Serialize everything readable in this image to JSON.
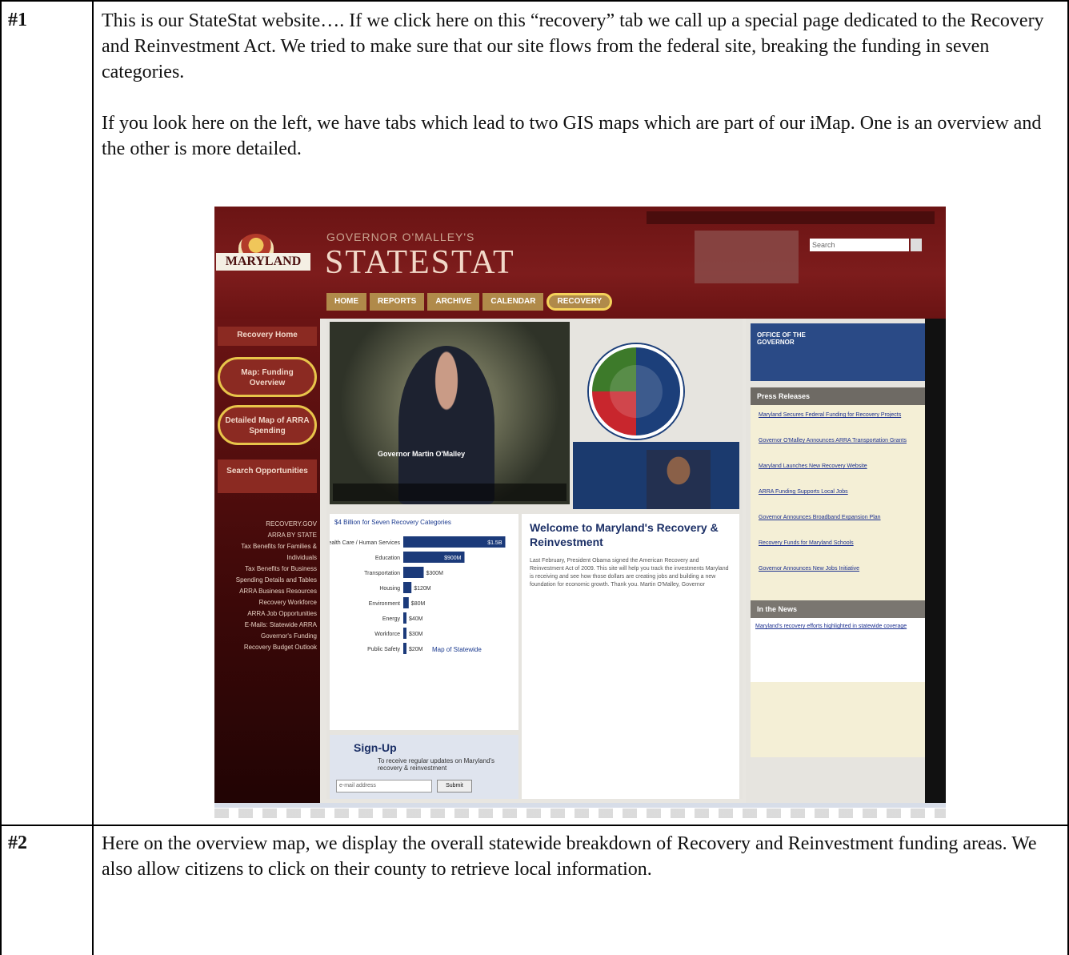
{
  "rows": [
    {
      "number": "#1",
      "paragraphs": [
        "This is our StateStat website…. If we click here on this “recovery” tab we call up a special page dedicated to the Recovery and Reinvestment Act.  We tried to make sure that our site flows from the federal site, breaking the funding in seven categories.",
        "If you look here on the left, we have tabs which lead to two GIS maps which are part of our iMap.  One is an overview and the other is more detailed."
      ]
    },
    {
      "number": "#2",
      "paragraphs": [
        "Here on the overview map, we display the overall statewide breakdown of Recovery and Reinvestment funding areas.  We also allow citizens to click on their county to retrieve local information."
      ]
    }
  ],
  "screenshot": {
    "logo_text": "MARYLAND",
    "governor_line": "GOVERNOR O'MALLEY'S",
    "site_title": "STATESTAT",
    "search_placeholder": "Search",
    "tabs": [
      "HOME",
      "REPORTS",
      "ARCHIVE",
      "CALENDAR",
      "RECOVERY"
    ],
    "left_nav": {
      "recovery_home": "Recovery Home",
      "funding_overview": "Map: Funding Overview",
      "detailed_map": "Detailed Map of ARRA Spending",
      "search_opportunities": "Search Opportunities",
      "links": [
        "RECOVERY.GOV",
        "ARRA BY STATE",
        "Tax Benefits for Families & Individuals",
        "Tax Benefits for Business",
        "Spending Details and Tables",
        "ARRA Business Resources",
        "Recovery Workforce",
        "ARRA Job Opportunities",
        "E-Mails: Statewide ARRA",
        "Governor's Funding",
        "Recovery Budget Outlook"
      ]
    },
    "video_caption": "Governor Martin O'Malley",
    "chart": {
      "title": "$4 Billion for Seven Recovery Categories",
      "link": "Map of Statewide"
    },
    "signup": {
      "title": "Sign-Up",
      "text": "To receive regular updates on Maryland's recovery & reinvestment",
      "input_placeholder": "e-mail address",
      "button": "Submit"
    },
    "welcome": {
      "title": "Welcome to Maryland's Recovery & Reinvestment",
      "body": "Last February, President Obama signed the American Recovery and Reinvestment Act of 2009. This site will help you track the investments Maryland is receiving and see how those dollars are creating jobs and building a new foundation for economic growth. Thank you. Martin O'Malley, Governor"
    },
    "right": {
      "banner": "OFFICE OF THE GOVERNOR",
      "press_head": "Press Releases",
      "press_items": [
        "Maryland Secures Federal Funding for Recovery Projects",
        "Governor O'Malley Announces ARRA Transportation Grants",
        "Maryland Launches New Recovery Website",
        "ARRA Funding Supports Local Jobs",
        "Governor Announces Broadband Expansion Plan",
        "Recovery Funds for Maryland Schools",
        "Governor Announces New Jobs Initiative"
      ],
      "news_head": "In the News",
      "news_body": "Maryland's recovery efforts highlighted in statewide coverage"
    },
    "chart_data": {
      "type": "bar",
      "title": "$4 Billion for Seven Recovery Categories",
      "categories": [
        "Health Care / Human Services",
        "Education",
        "Transportation",
        "Housing",
        "Environment",
        "Energy",
        "Workforce",
        "Public Safety"
      ],
      "values": [
        1500,
        900,
        300,
        120,
        80,
        40,
        30,
        20
      ],
      "value_labels": [
        "$1.5B",
        "$900M",
        "$300M",
        "$120M",
        "$80M",
        "$40M",
        "$30M",
        "$20M"
      ],
      "xlim": [
        0,
        1600
      ]
    }
  }
}
